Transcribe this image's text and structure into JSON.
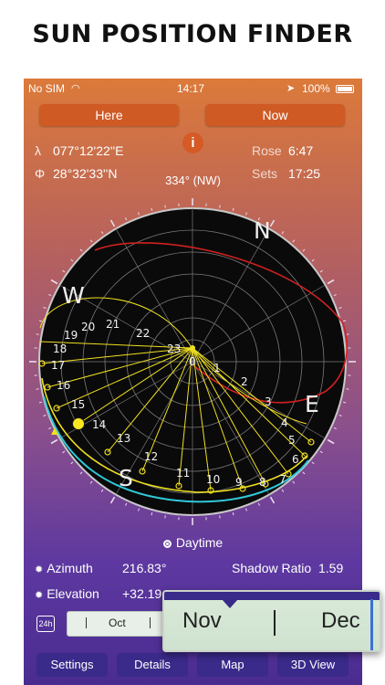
{
  "headline": "SUN POSITION FINDER",
  "status_bar": {
    "carrier": "No SIM",
    "time": "14:17",
    "battery": "100%"
  },
  "buttons": {
    "here": "Here",
    "now": "Now",
    "info": "i"
  },
  "location": {
    "longitude_symbol": "λ",
    "longitude": "077°12'22''E",
    "latitude_symbol": "Φ",
    "latitude": "28°32'33''N"
  },
  "sun_times": {
    "rose_label": "Rose",
    "rose_time": "6:47",
    "sets_label": "Sets",
    "sets_time": "17:25"
  },
  "heading": "334° (NW)",
  "compass": {
    "cardinals": {
      "n": "N",
      "e": "E",
      "s": "S",
      "w": "W"
    },
    "hour_labels": [
      "0",
      "1",
      "2",
      "3",
      "4",
      "5",
      "6",
      "7",
      "8",
      "9",
      "10",
      "11",
      "12",
      "13",
      "14",
      "15",
      "16",
      "17",
      "18",
      "19",
      "20",
      "21",
      "22",
      "23"
    ],
    "colors": {
      "dial": "#0a0a0a",
      "yellow": "#f0e020",
      "red": "#d02020",
      "cyan": "#30c8d8",
      "grid": "#7a7a7a"
    }
  },
  "daytime_label": "Daytime",
  "stats": {
    "azimuth_label": "Azimuth",
    "azimuth": "216.83°",
    "elevation_label": "Elevation",
    "elevation": "+32.19",
    "shadow_label": "Shadow Ratio",
    "shadow": "1.59"
  },
  "timeline": {
    "mode": "24h",
    "month": "Oct"
  },
  "magnifier": {
    "month_left": "Nov",
    "month_right": "Dec"
  },
  "tabs": {
    "settings": "Settings",
    "details": "Details",
    "map": "Map",
    "view3d": "3D View"
  }
}
